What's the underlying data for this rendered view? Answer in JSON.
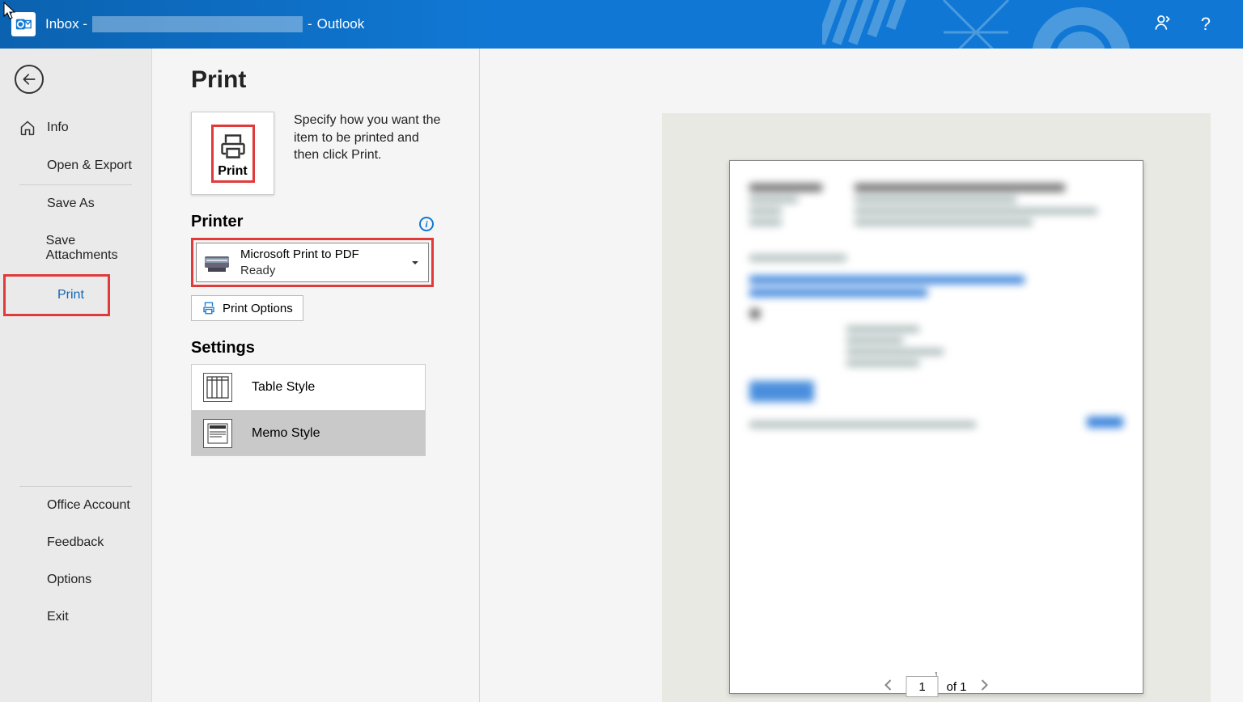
{
  "titlebar": {
    "prefix": "Inbox -",
    "sep": "-",
    "app": "Outlook"
  },
  "sidebar": {
    "info": "Info",
    "open_export": "Open & Export",
    "save_as": "Save As",
    "save_attachments": "Save Attachments",
    "print": "Print",
    "office_account": "Office Account",
    "feedback": "Feedback",
    "options": "Options",
    "exit": "Exit"
  },
  "page": {
    "title": "Print",
    "print_button": "Print",
    "description": "Specify how you want the item to be printed and then click Print.",
    "printer_header": "Printer",
    "printer_name": "Microsoft Print to PDF",
    "printer_status": "Ready",
    "print_options": "Print Options",
    "settings_header": "Settings",
    "style_table": "Table Style",
    "style_memo": "Memo Style"
  },
  "pager": {
    "current": "1",
    "of": "of 1"
  },
  "preview": {
    "page_number": "1"
  }
}
